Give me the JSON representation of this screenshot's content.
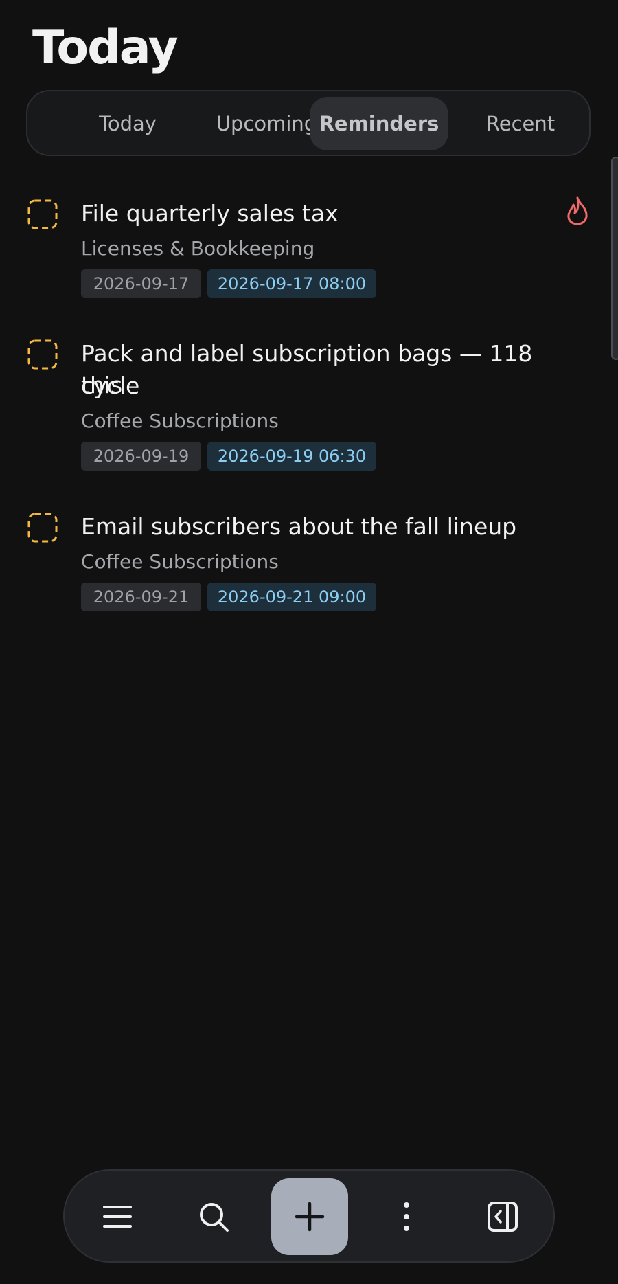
{
  "header": {
    "title": "Today"
  },
  "tabs": [
    {
      "label": "Today",
      "active": false
    },
    {
      "label": "Upcoming",
      "active": false
    },
    {
      "label": "Reminders",
      "active": true
    },
    {
      "label": "Recent",
      "active": false
    }
  ],
  "tasks": [
    {
      "title_line1": "File quarterly sales tax",
      "title_line2": "",
      "project": "Licenses & Bookkeeping",
      "date": "2026-09-17",
      "reminder": "2026-09-17 08:00",
      "priority_icon": "flame-icon"
    },
    {
      "title_line1": "Pack and label subscription bags — 118 this",
      "title_line2": "cycle",
      "project": "Coffee Subscriptions",
      "date": "2026-09-19",
      "reminder": "2026-09-19 06:30"
    },
    {
      "title_line1": "Email subscribers about the fall lineup",
      "title_line2": "",
      "project": "Coffee Subscriptions",
      "date": "2026-09-21",
      "reminder": "2026-09-21 09:00"
    }
  ],
  "bottom_bar": {
    "icons": [
      "menu-icon",
      "search-icon",
      "plus-icon",
      "more-vertical-icon",
      "collapse-panel-icon"
    ]
  },
  "colors": {
    "background": "#111112",
    "checkbox": "#f5b942",
    "flame": "#f06a6a",
    "reminder_chip_text": "#8ccdf2",
    "add_button": "#a8adba"
  }
}
